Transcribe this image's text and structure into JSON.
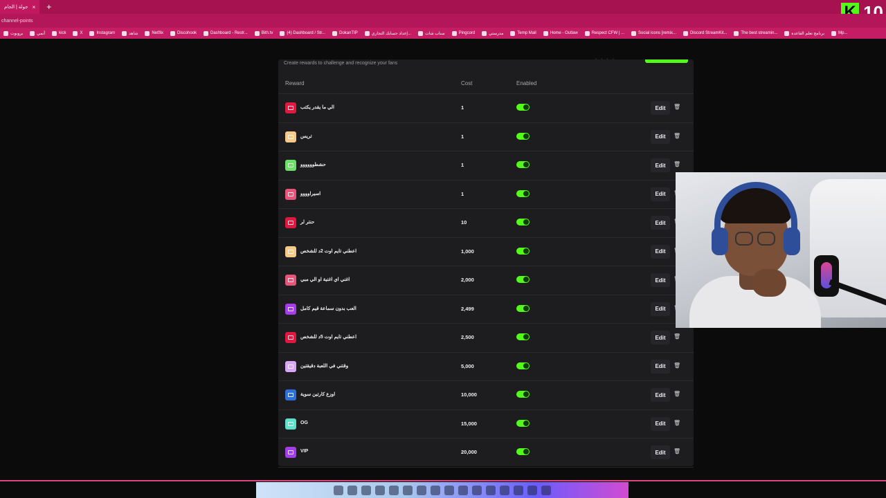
{
  "browser": {
    "tab_title": "جولة | الجام",
    "tab_close": "×",
    "new_tab": "+",
    "url": "channel-points",
    "kick_badge": {
      "letter": "K",
      "count": "10"
    },
    "bookmarks": [
      "بروبوت",
      "أنمي",
      "kick",
      "X",
      "Instagram",
      "شاهد",
      "Netflix",
      "Discohook",
      "Dashboard - Restr...",
      "Bith.tv",
      "(4) Dashboard / Str...",
      "DokanTIP",
      "إعداد حسابك التجاري...",
      "سناب شات",
      "Pingcord",
      "مدرستي",
      "Temp Mail",
      "Home - Outlaw",
      "Respect CFW | ...",
      "Social icons [remix...",
      "Discord StreamKit...",
      "The best streamin...",
      "برنامج تعلم القاعدة",
      "Mp..."
    ]
  },
  "panel": {
    "subtitle": "Create rewards to challenge and recognize your fans",
    "top_dots": "· · · ·",
    "columns": {
      "reward": "Reward",
      "cost": "Cost",
      "enabled": "Enabled"
    },
    "edit_label": "Edit",
    "trash_icon": "🗑"
  },
  "rewards": [
    {
      "title": "الي ما يقدر يكتب",
      "cost": "1",
      "color": "#e0173f"
    },
    {
      "title": "تريس",
      "cost": "1",
      "color": "#f4c98a"
    },
    {
      "title": "حشطوووووو",
      "cost": "1",
      "color": "#6ee06a"
    },
    {
      "title": "اسيراوووو",
      "cost": "1",
      "color": "#e8557a"
    },
    {
      "title": "حنتر لر",
      "cost": "10",
      "color": "#e0173f"
    },
    {
      "title": "اعطني تايم اوت 2د للشخص",
      "cost": "1,000",
      "color": "#f4c98a"
    },
    {
      "title": "اغني اي اغنية او الي مبي",
      "cost": "2,000",
      "color": "#e8557a"
    },
    {
      "title": "العب بدون سماعة قيم كامل",
      "cost": "2,499",
      "color": "#a43ee8"
    },
    {
      "title": "اعطني تايم اوت 5د للشخص",
      "cost": "2,500",
      "color": "#e0173f"
    },
    {
      "title": "وقتني في اللعبة دقيقتين",
      "cost": "5,000",
      "color": "#d9a7f5"
    },
    {
      "title": "اوزع كارتين سوية",
      "cost": "10,000",
      "color": "#2f6fd8"
    },
    {
      "title": "OG",
      "cost": "15,000",
      "color": "#5fe0c8"
    },
    {
      "title": "VIP",
      "cost": "20,000",
      "color": "#a43ee8"
    }
  ],
  "taskbar_icons": [
    "start-icon",
    "search-icon",
    "taskview-icon",
    "files-icon",
    "app-a-icon",
    "app-r-icon",
    "code-icon",
    "app-icon",
    "settings-icon",
    "store-icon",
    "discord-icon",
    "steam-icon",
    "calendar-icon",
    "folder-icon",
    "edge-icon",
    "notes-icon"
  ]
}
